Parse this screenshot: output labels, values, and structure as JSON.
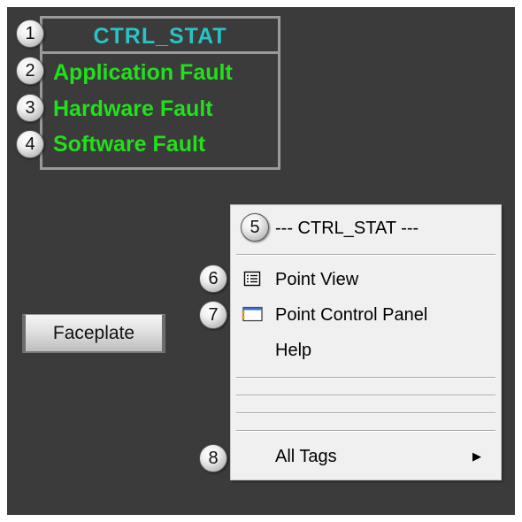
{
  "status_panel": {
    "title": "CTRL_STAT",
    "faults": [
      "Application Fault",
      "Hardware Fault",
      "Software Fault"
    ]
  },
  "faceplate": {
    "label": "Faceplate"
  },
  "context_menu": {
    "title": "--- CTRL_STAT ---",
    "items": {
      "point_view": "Point View",
      "point_control_panel": "Point Control Panel",
      "help": "Help",
      "all_tags": "All Tags"
    }
  },
  "callouts": [
    "1",
    "2",
    "3",
    "4",
    "5",
    "6",
    "7",
    "8"
  ],
  "colors": {
    "background": "#3b3b3b",
    "title_cyan": "#29c3c6",
    "fault_green": "#22e01b",
    "panel_border": "#9a9a9a",
    "menu_bg": "#f0f0f0"
  },
  "icons": {
    "point_view": "point-view-icon",
    "point_control_panel": "point-control-panel-icon",
    "submenu": "submenu-arrow-icon"
  }
}
